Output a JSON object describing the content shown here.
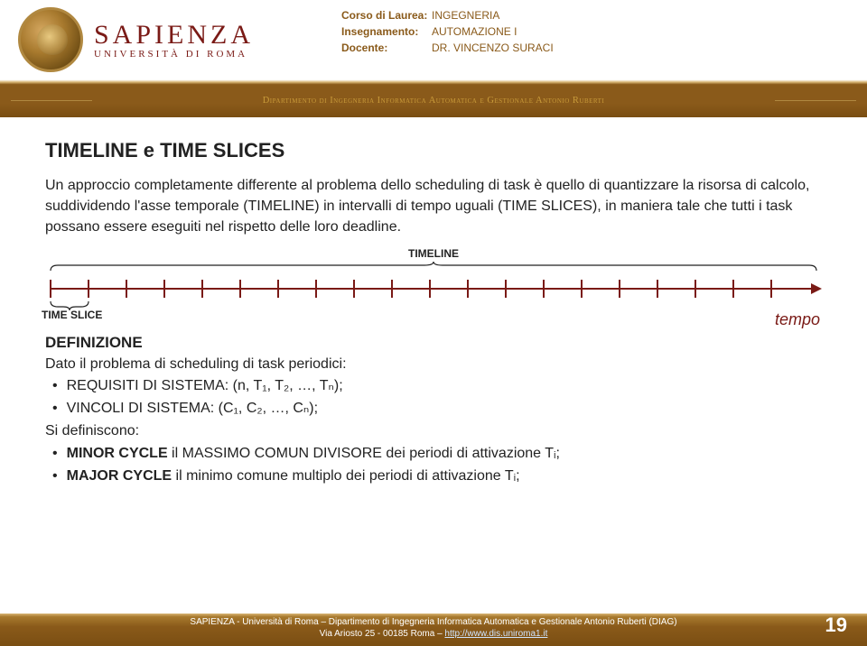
{
  "logo": {
    "main": "SAPIENZA",
    "sub": "UNIVERSITÀ DI ROMA"
  },
  "course": {
    "rows": [
      {
        "label": "Corso di Laurea:",
        "value": "INGEGNERIA"
      },
      {
        "label": "Insegnamento:",
        "value": "AUTOMAZIONE I"
      },
      {
        "label": "Docente:",
        "value": "DR. VINCENZO SURACI"
      }
    ]
  },
  "dept": "Dipartimento di Ingegneria Informatica Automatica e Gestionale Antonio Ruberti",
  "title": "TIMELINE e TIME SLICES",
  "paragraph": "Un approccio completamente differente al problema dello scheduling di task è quello di quantizzare la risorsa di calcolo, suddividendo l'asse temporale (TIMELINE) in intervalli di tempo uguali (TIME SLICES), in maniera tale che tutti i task possano essere eseguiti nel rispetto delle loro deadline.",
  "timeline": {
    "label": "TIMELINE",
    "slice_label": "TIME SLICE",
    "axis_label": "tempo"
  },
  "def_heading": "DEFINIZIONE",
  "def_intro": "Dato il problema di scheduling di task periodici:",
  "bullets1": [
    "REQUISITI DI SISTEMA: (n, T₁, T₂, …, Tₙ);",
    "VINCOLI DI SISTEMA: (C₁, C₂, …, Cₙ);"
  ],
  "def_mid": "Si definiscono:",
  "bullets2": [
    {
      "bold": "MINOR CYCLE",
      "rest": " il MASSIMO COMUN DIVISORE dei periodi di attivazione Tᵢ;"
    },
    {
      "bold": "MAJOR CYCLE",
      "rest": " il minimo comune multiplo dei periodi di attivazione Tᵢ;"
    }
  ],
  "footer": {
    "line1": "SAPIENZA - Università di Roma – Dipartimento di Ingegneria Informatica Automatica e Gestionale Antonio Ruberti (DIAG)",
    "line2_pre": "Via Ariosto 25 - 00185 Roma – ",
    "link": "http://www.dis.uniroma1.it"
  },
  "page": "19"
}
